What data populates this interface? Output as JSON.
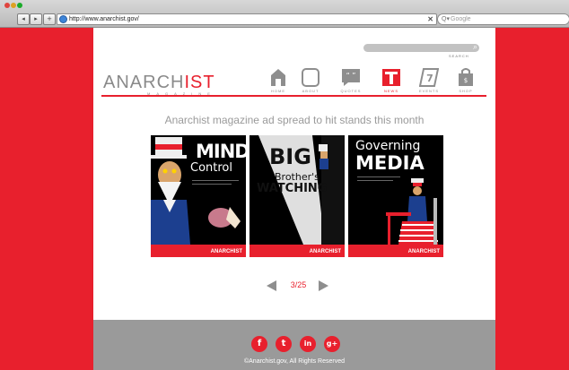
{
  "browser": {
    "url": "http://www.anarchist.gov/",
    "search_placeholder": "Google",
    "back_glyph": "◂",
    "forward_glyph": "▸",
    "add_glyph": "+",
    "clear_glyph": "✕",
    "search_glyph": "Q▾"
  },
  "site": {
    "logo_main": "ANARCH",
    "logo_accent": "IST",
    "logo_sub": "MAGAZINE",
    "search_label": "SEARCH",
    "accent_color": "#e8202d",
    "nav": [
      {
        "label": "HOME",
        "icon": "house-icon",
        "active": false
      },
      {
        "label": "ABOUT",
        "icon": "square-icon",
        "active": false
      },
      {
        "label": "QUOTES",
        "icon": "quote-bubble-icon",
        "active": false
      },
      {
        "label": "NEWS",
        "icon": "newspaper-icon",
        "active": true
      },
      {
        "label": "EVENTS",
        "icon": "calendar-icon",
        "active": false
      },
      {
        "label": "SHOP",
        "icon": "shopping-bag-icon",
        "active": false
      }
    ],
    "headline": "Anarchist magazine ad spread to hit stands this month",
    "ads": [
      {
        "line1": "MIND",
        "line2": "Control",
        "brand": "ANARCHIST"
      },
      {
        "line1": "BIG",
        "line2": "Brother's",
        "line3": "WATCHING",
        "brand": "ANARCHIST"
      },
      {
        "line1": "Governing",
        "line2": "MEDIA",
        "brand": "ANARCHIST"
      }
    ],
    "pager": "3/25",
    "social": [
      {
        "glyph": "f",
        "icon": "facebook-icon"
      },
      {
        "glyph": "t",
        "icon": "twitter-icon"
      },
      {
        "glyph": "in",
        "icon": "linkedin-icon"
      },
      {
        "glyph": "g+",
        "icon": "google-plus-icon"
      }
    ],
    "copyright": "©Anarchist.gov, All Rights Reserved"
  }
}
